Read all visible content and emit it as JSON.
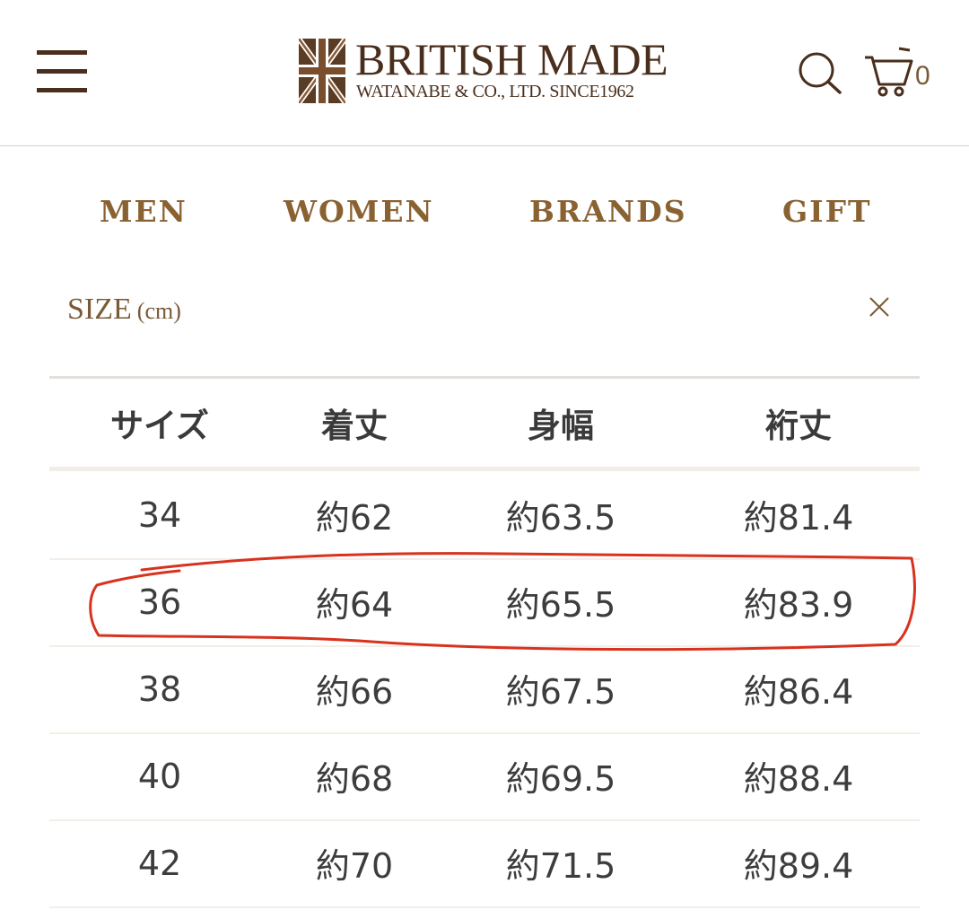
{
  "header": {
    "logo_title": "BRITISH MADE",
    "logo_subtitle": "WATANABE & CO., LTD. SINCE1962",
    "cart_count": "0"
  },
  "nav": {
    "items": [
      {
        "label": "MEN"
      },
      {
        "label": "WOMEN"
      },
      {
        "label": "BRANDS"
      },
      {
        "label": "GIFT"
      }
    ]
  },
  "size_panel": {
    "title": "SIZE",
    "unit": "(cm)",
    "close_symbol": "×",
    "columns": [
      "サイズ",
      "着丈",
      "身幅",
      "裄丈"
    ],
    "rows": [
      [
        "34",
        "約62",
        "約63.5",
        "約81.4"
      ],
      [
        "36",
        "約64",
        "約65.5",
        "約83.9"
      ],
      [
        "38",
        "約66",
        "約67.5",
        "約86.4"
      ],
      [
        "40",
        "約68",
        "約69.5",
        "約88.4"
      ],
      [
        "42",
        "約70",
        "約71.5",
        "約89.4"
      ]
    ],
    "highlighted_row": "36"
  },
  "colors": {
    "brand_brown": "#4a2e1d",
    "nav_gold": "#8a6232",
    "annotation_red": "#d8321e"
  }
}
